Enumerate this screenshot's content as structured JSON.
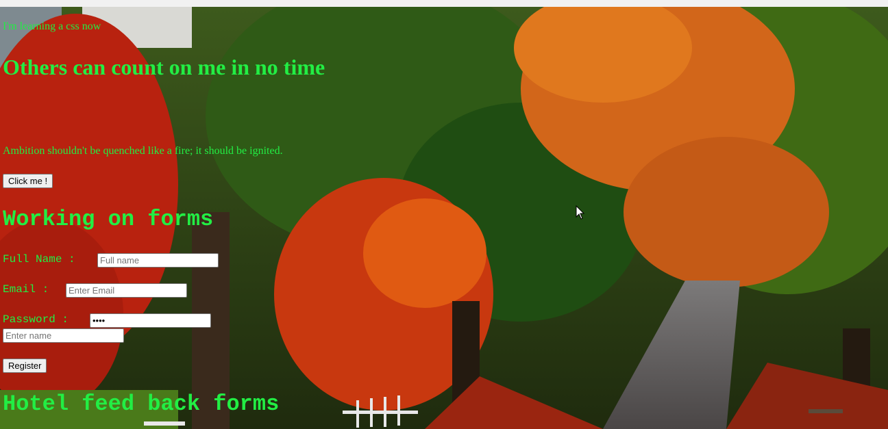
{
  "intro_text": "I'm learning a css now",
  "main_heading": "Others can count on me in no time",
  "quote": "Ambition shouldn't be quenched like a fire; it should be ignited.",
  "click_button_label": "Click me !",
  "forms_heading": "Working on forms",
  "form": {
    "full_name_label": "Full Name :",
    "full_name_placeholder": "Full name",
    "email_label": "Email :",
    "email_placeholder": "Enter Email",
    "password_label": "Password :",
    "password_value": "1234",
    "extra_placeholder": "Enter name",
    "register_label": "Register"
  },
  "hotel_heading": "Hotel feed back forms",
  "colors": {
    "heading_text": "#22ee44"
  }
}
